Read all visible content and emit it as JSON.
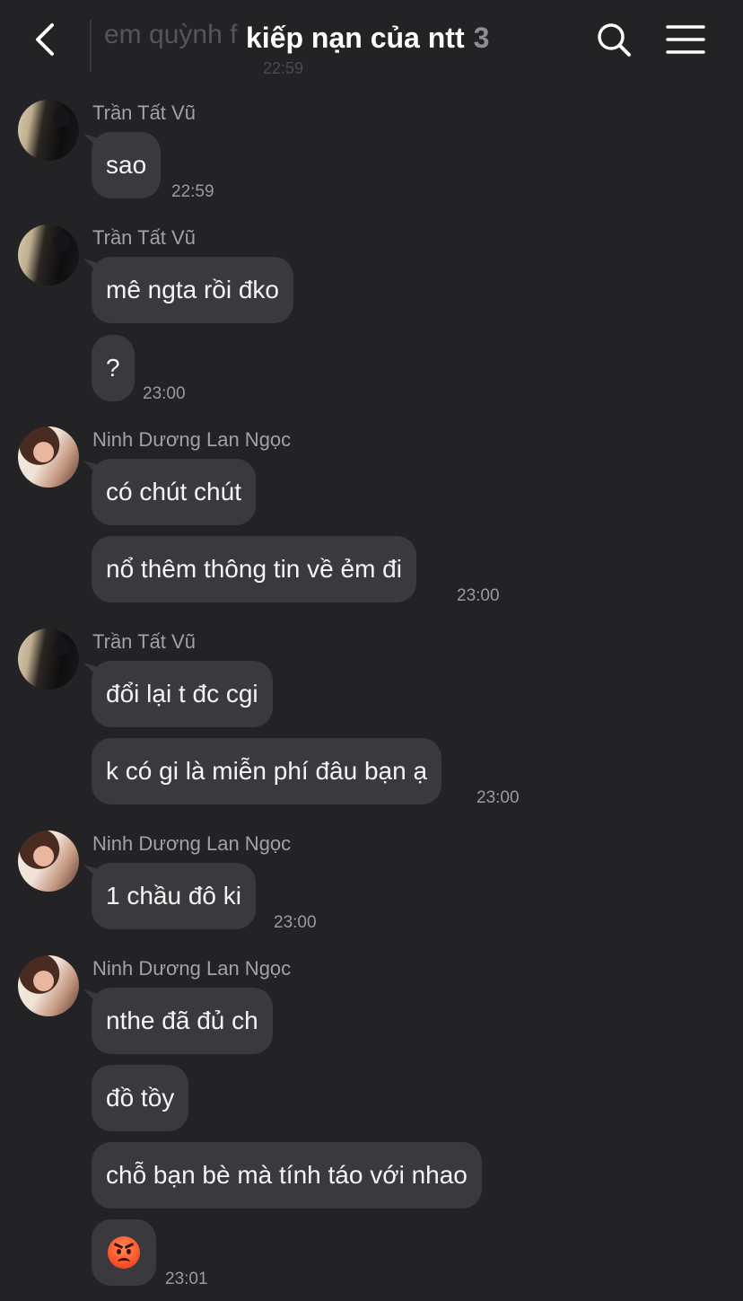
{
  "header": {
    "ghost_preview_text": "em quỳnh f",
    "ghost_preview_time": "22:59",
    "title": "kiếp nạn của ntt",
    "member_count": "3",
    "back_icon": "chevron-left-icon",
    "search_icon": "search-icon",
    "menu_icon": "hamburger-menu-icon"
  },
  "messages": [
    {
      "sender": "Trần Tất Vũ",
      "text": "sao",
      "time": "22:59"
    },
    {
      "sender": "Trần Tất Vũ",
      "text": "mê ngta rồi đko"
    },
    {
      "text": "?",
      "time": "23:00"
    },
    {
      "sender": "Ninh Dương Lan Ngọc",
      "text": "có chút chút"
    },
    {
      "text": "nổ thêm thông tin về ẻm đi",
      "time": "23:00"
    },
    {
      "sender": "Trần Tất Vũ",
      "text": "đổi lại t đc cgi"
    },
    {
      "text": "k có gi là miễn phí đâu bạn ạ",
      "time": "23:00"
    },
    {
      "sender": "Ninh Dương Lan Ngọc",
      "text": "1 chầu đô ki",
      "time": "23:00"
    },
    {
      "sender": "Ninh Dương Lan Ngọc",
      "text": "nthe đã đủ ch"
    },
    {
      "text": "đồ tồy"
    },
    {
      "text": "chỗ bạn bè mà tính táo với nhao"
    },
    {
      "emoji": "angry-face-emoji",
      "time": "23:01"
    }
  ]
}
